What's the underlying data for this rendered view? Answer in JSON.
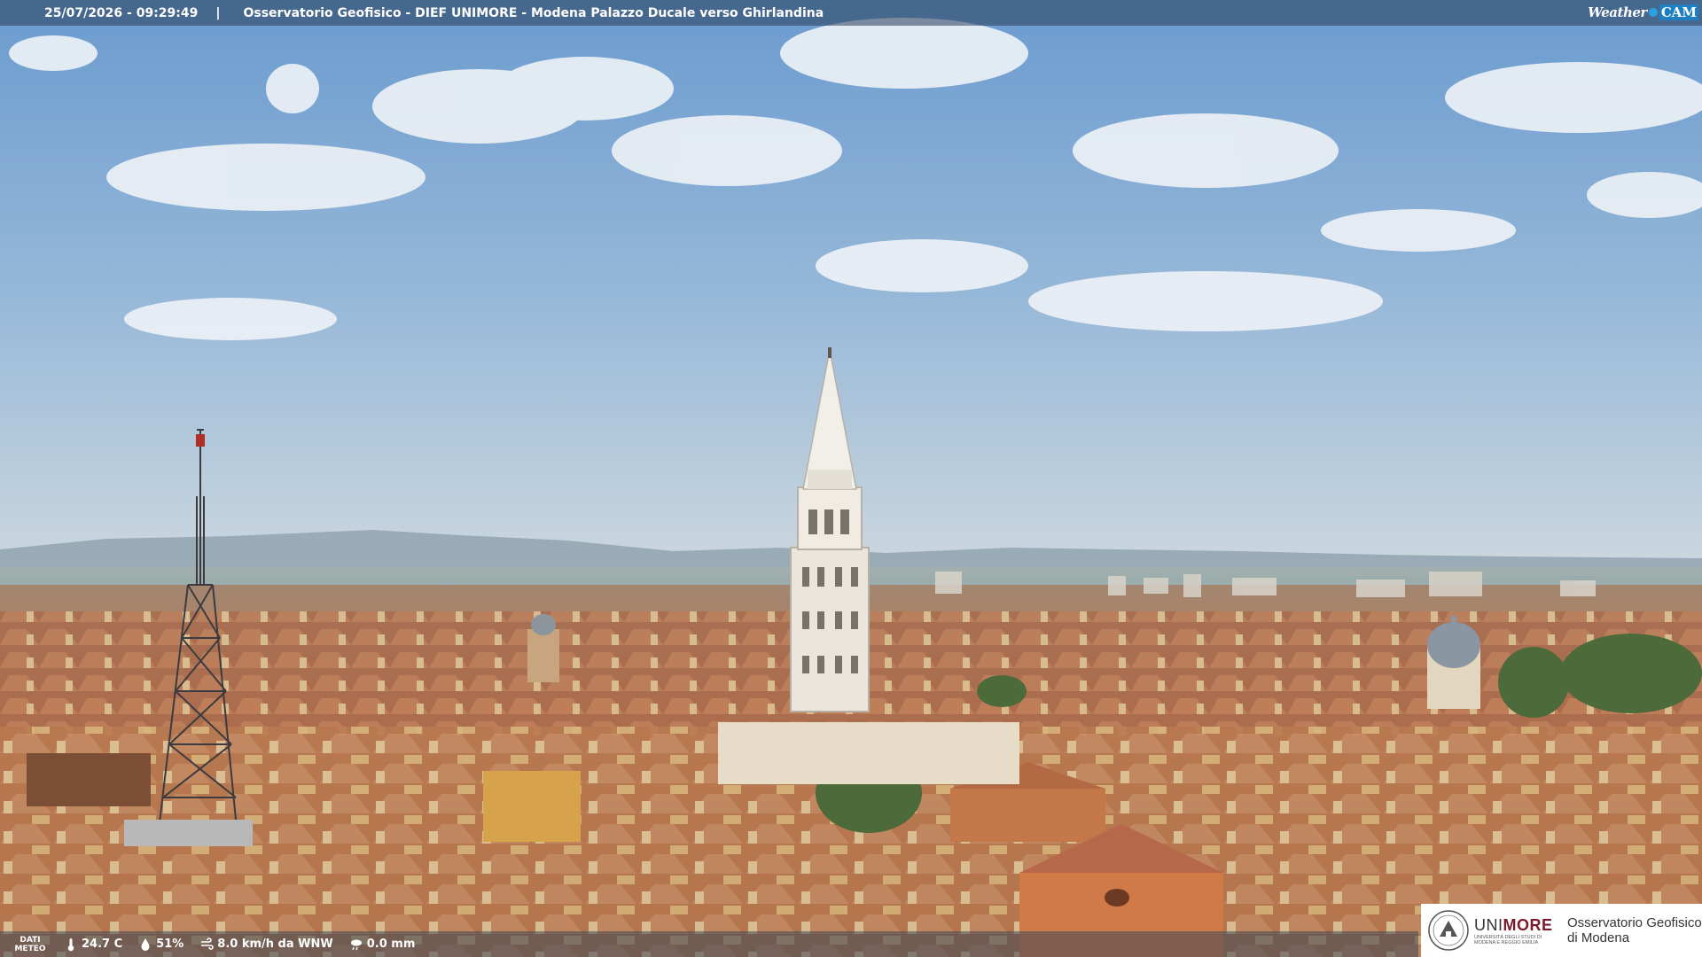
{
  "overlay": {
    "timestamp": "25/07/2026 - 09:29:49",
    "separator": "|",
    "title": "Osservatorio Geofisico - DIEF UNIMORE - Modena Palazzo Ducale verso Ghirlandina",
    "brand": {
      "part1": "Weather",
      "part2": "CAM"
    }
  },
  "weather": {
    "label_line1": "DATI",
    "label_line2": "METEO",
    "temperature": "24.7 C",
    "humidity": "51%",
    "wind": "8.0 km/h da WNW",
    "rain": "0.0 mm"
  },
  "institution": {
    "name_part1": "UNI",
    "name_part2": "MORE",
    "subtitle": "UNIVERSITÀ DEGLI STUDI DI MODENA E REGGIO EMILIA",
    "observatory_line1": "Osservatorio Geofisico",
    "observatory_line2": "di Modena"
  },
  "colors": {
    "sky_top": "#6f9fd0",
    "sky_horizon": "#c9d6e0",
    "roof": "#b87a55",
    "tower": "#e8e4dc",
    "accent": "#7a1a2a"
  },
  "icons": [
    "thermometer-icon",
    "droplet-icon",
    "wind-icon",
    "rain-icon",
    "unimore-seal-icon",
    "weathercam-logo"
  ]
}
